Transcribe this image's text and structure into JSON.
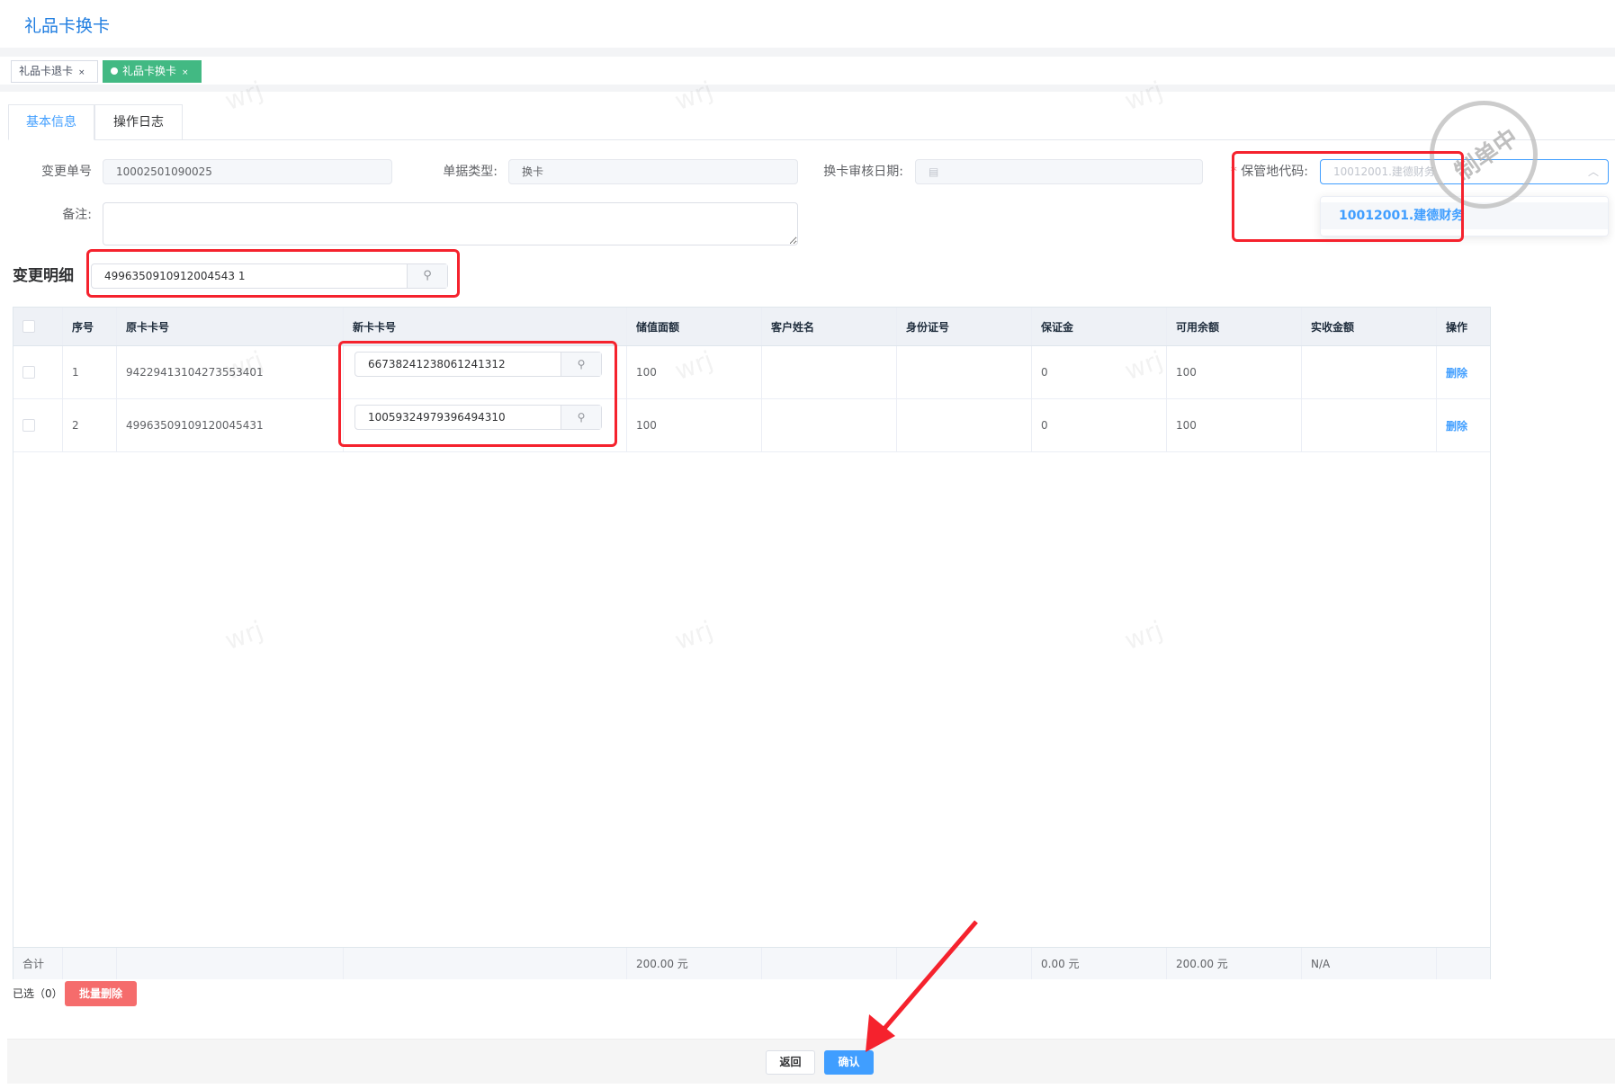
{
  "page_title": "礼品卡换卡",
  "tags": [
    {
      "label": "礼品卡退卡",
      "close": "×"
    },
    {
      "label": "礼品卡换卡",
      "close": "×"
    }
  ],
  "tabs": [
    {
      "label": "基本信息"
    },
    {
      "label": "操作日志"
    }
  ],
  "form": {
    "change_no": {
      "label": "变更单号",
      "value": "10002501090025"
    },
    "doc_type": {
      "label": "单据类型:",
      "value": "换卡"
    },
    "review_date": {
      "label": "换卡审核日期:",
      "value": ""
    },
    "custody_code": {
      "label": "保管地代码:",
      "required": "*",
      "placeholder": "10012001.建德财务",
      "options": [
        "10012001.建德财务"
      ]
    },
    "remark": {
      "label": "备注:",
      "value": ""
    }
  },
  "stamp": "制单中",
  "watermark": "wrj",
  "detail": {
    "title": "变更明细",
    "search_value": "4996350910912004543 1"
  },
  "table": {
    "columns": [
      "序号",
      "原卡卡号",
      "新卡卡号",
      "储值面额",
      "客户姓名",
      "身份证号",
      "保证金",
      "可用余额",
      "实收金额",
      "操作"
    ],
    "rows": [
      {
        "no": "1",
        "old_card": "94229413104273553401",
        "new_card": "66738241238061241312",
        "face": "100",
        "name": "",
        "id": "",
        "deposit": "0",
        "balance": "100",
        "received": "",
        "action": "删除"
      },
      {
        "no": "2",
        "old_card": "49963509109120045431",
        "new_card": "10059324979396494310",
        "face": "100",
        "name": "",
        "id": "",
        "deposit": "0",
        "balance": "100",
        "received": "",
        "action": "删除"
      }
    ],
    "footer": {
      "label": "合计",
      "face": "200.00 元",
      "deposit": "0.00 元",
      "balance": "200.00 元",
      "received": "N/A"
    }
  },
  "selected_label": "已选（0）",
  "batch_delete": "批量删除",
  "back": "返回",
  "confirm": "确认",
  "colors": {
    "accent": "#409eff",
    "tag_active": "#42b983",
    "danger": "#f56c6c",
    "annotation": "#f5222d"
  }
}
